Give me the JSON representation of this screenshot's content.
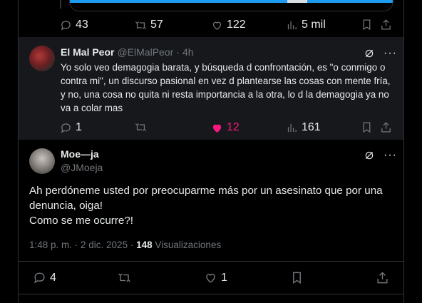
{
  "previous_tweet": {
    "replies": "43",
    "reposts": "57",
    "likes": "122",
    "views": "5 mil"
  },
  "reply_tweet": {
    "display_name": "El Mal Peor",
    "handle": "@ElMalPeor",
    "time_sep": "·",
    "time": "4h",
    "text": "Yo solo veo demagogia barata, y búsqueda d confrontación, es \"o conmigo o contra mi\", un discurso pasional en vez d plantearse las cosas con mente fría, y no, una cosa no quita ni resta importancia a la otra, lo d la demagogia ya no va a colar mas",
    "replies": "1",
    "likes": "12",
    "views": "161",
    "like_color": "#f91880"
  },
  "main_tweet": {
    "display_name": "Moe—ja",
    "handle": "@JMoeja",
    "line1": "Ah perdóneme usted por preocuparme más por un asesinato que por una denuncia, oiga!",
    "line2": "Como se me ocurre?!",
    "timestamp": "1:48 p. m. · 2 dic. 2025 ·",
    "views_count": "148",
    "views_label": "Visualizaciones",
    "replies": "4",
    "likes": "1"
  },
  "icons": [
    "reply-icon",
    "repost-icon",
    "like-icon",
    "views-icon",
    "bookmark-icon",
    "share-icon",
    "grok-icon",
    "more-icon"
  ],
  "colors": {
    "accent": "#1d9bf0",
    "background": "#000000",
    "muted": "#71767b"
  }
}
